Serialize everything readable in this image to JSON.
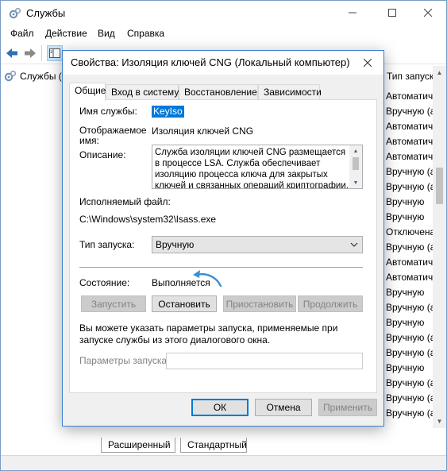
{
  "app": {
    "title": "Службы",
    "menu": [
      "Файл",
      "Действие",
      "Вид",
      "Справка"
    ],
    "tree_item": "Службы (",
    "column_header": "Тип запуска",
    "column_cells": [
      "Автоматич",
      "Вручную (а",
      "Автоматич",
      "Автоматич",
      "Автоматич",
      "Вручную (а",
      "Вручную (а",
      "Вручную",
      "Вручную",
      "Отключена",
      "Вручную (а",
      "Автоматич",
      "Автоматич",
      "Вручную",
      "Вручную (а",
      "Вручную",
      "Вручную (а",
      "Вручную (а",
      "Вручную",
      "Вручную (а",
      "Вручную (а",
      "Вручную (а"
    ],
    "bottom_tabs": [
      "Расширенный",
      "Стандартный"
    ]
  },
  "dialog": {
    "title": "Свойства: Изоляция ключей CNG (Локальный компьютер)",
    "tabs": [
      "Общие",
      "Вход в систему",
      "Восстановление",
      "Зависимости"
    ],
    "service_name_label": "Имя службы:",
    "service_name_value": "KeyIso",
    "display_name_label": "Отображаемое имя:",
    "display_name_value": "Изоляция ключей CNG",
    "description_label": "Описание:",
    "description_value": "Служба изоляции ключей CNG размещается в процессе LSA. Служба обеспечивает изоляцию процесса ключа для закрытых ключей и связанных операций криптографии.",
    "exe_label": "Исполняемый файл:",
    "exe_value": "C:\\Windows\\system32\\lsass.exe",
    "startup_type_label": "Тип запуска:",
    "startup_type_value": "Вручную",
    "status_label": "Состояние:",
    "status_value": "Выполняется",
    "buttons": {
      "start": "Запустить",
      "stop": "Остановить",
      "pause": "Приостановить",
      "resume": "Продолжить"
    },
    "hint_text": "Вы можете указать параметры запуска, применяемые при запуске службы из этого диалогового окна.",
    "params_label": "Параметры запуска:",
    "params_value": "",
    "ok": "ОК",
    "cancel": "Отмена",
    "apply": "Применить"
  },
  "colors": {
    "selection": "#0078d7",
    "arrow_annotation": "#3a8fd6",
    "dialog_border": "#3c7fd4"
  }
}
